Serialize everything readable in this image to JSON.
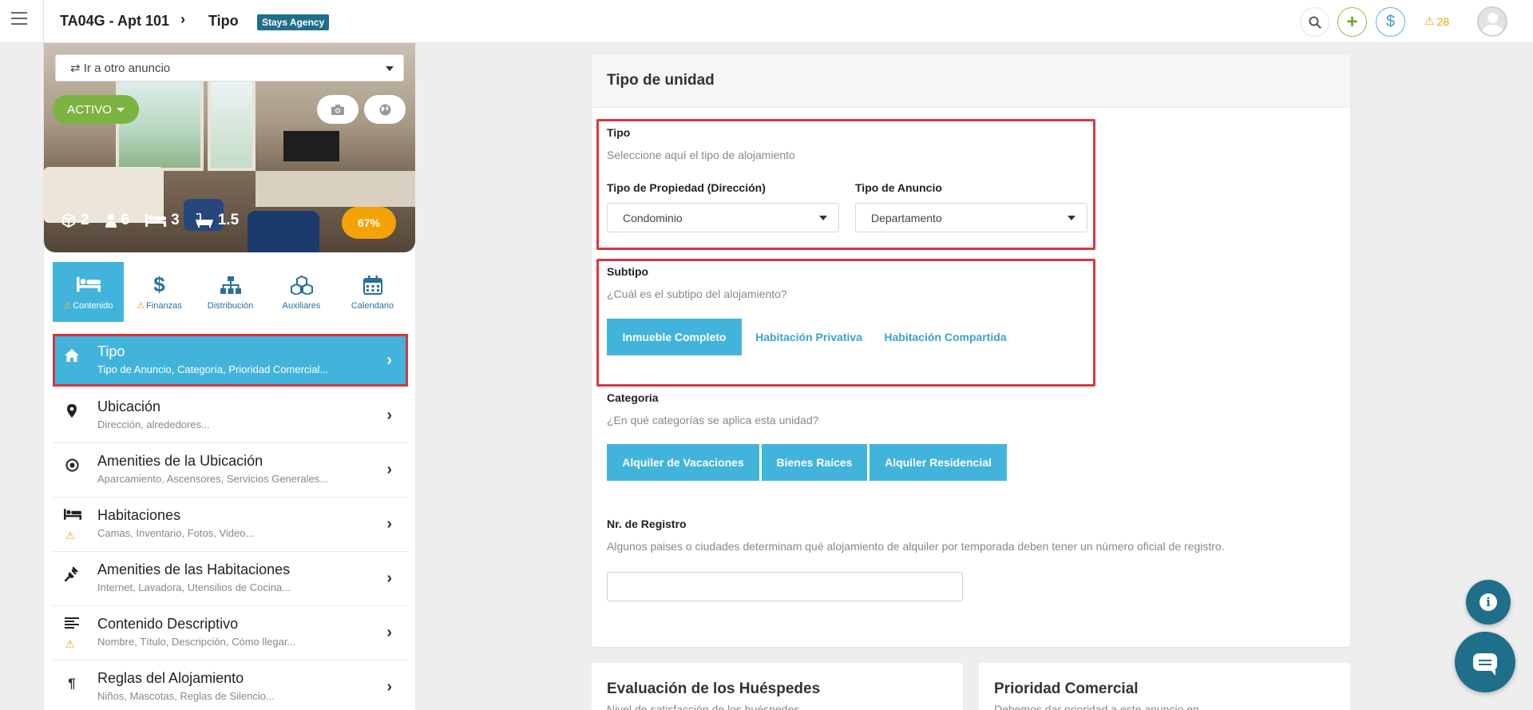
{
  "topbar": {
    "breadcrumb_listing": "TA04G - Apt 101",
    "breadcrumb_separator": "›",
    "breadcrumb_page": "Tipo",
    "agency_badge": "Stays Agency",
    "alert_count": "28",
    "colors": {
      "add": "#8bc34a",
      "money": "#3a9fd4",
      "alert": "#f0a30a",
      "badge": "#1f6f8b"
    }
  },
  "listing": {
    "goto_placeholder": "⇄ Ir a otro anuncio",
    "status": "ACTIVO",
    "stats": [
      {
        "icon": "cube-icon",
        "value": "2"
      },
      {
        "icon": "guests-icon",
        "value": "6"
      },
      {
        "icon": "bed-icon",
        "value": "3"
      },
      {
        "icon": "bathtub-icon",
        "value": "1.5"
      }
    ],
    "completion": "67%"
  },
  "nav_tabs": [
    {
      "label": "Contenido",
      "icon": "bed-icon",
      "warning": true,
      "active": true
    },
    {
      "label": "Finanzas",
      "icon": "dollar-icon",
      "warning": true,
      "active": false
    },
    {
      "label": "Distribución",
      "icon": "sitemap-icon",
      "warning": false,
      "active": false
    },
    {
      "label": "Auxiliares",
      "icon": "cubes-icon",
      "warning": false,
      "active": false
    },
    {
      "label": "Calendario",
      "icon": "calendar-icon",
      "warning": false,
      "active": false
    }
  ],
  "menu": [
    {
      "title": "Tipo",
      "subtitle": "Tipo de Anuncio, Categoría, Prioridad Comercial...",
      "icon": "home-icon",
      "active": true,
      "warning": false
    },
    {
      "title": "Ubicación",
      "subtitle": "Dirección, alrededores...",
      "icon": "map-pin-icon",
      "active": false,
      "warning": false
    },
    {
      "title": "Amenities de la Ubicación",
      "subtitle": "Aparcamiento, Ascensores, Servicios Generales...",
      "icon": "dot-circle-icon",
      "active": false,
      "warning": false
    },
    {
      "title": "Habitaciones",
      "subtitle": "Camas, Inventario, Fotos, Video...",
      "icon": "bed-icon",
      "active": false,
      "warning": true
    },
    {
      "title": "Amenities de las Habitaciones",
      "subtitle": "Internet, Lavadora, Utensilios de Cocina...",
      "icon": "plug-icon",
      "active": false,
      "warning": false
    },
    {
      "title": "Contenido Descriptivo",
      "subtitle": "Nombre, Título, Descripción, Cómo llegar...",
      "icon": "align-left-icon",
      "active": false,
      "warning": true
    },
    {
      "title": "Reglas del Alojamiento",
      "subtitle": "Niños, Mascotas, Reglas de Silencio...",
      "icon": "paragraph-icon",
      "active": false,
      "warning": false
    }
  ],
  "main": {
    "card_title": "Tipo de unidad",
    "tipo": {
      "label": "Tipo",
      "help": "Seleccione aquí el tipo de alojamiento",
      "property_type_label": "Tipo de Propiedad (Dirección)",
      "property_type_value": "Condominio",
      "listing_type_label": "Tipo de Anuncio",
      "listing_type_value": "Departamento"
    },
    "subtipo": {
      "label": "Subtipo",
      "help": "¿Cuál es el subtipo del alojamiento?",
      "options": [
        "Inmueble Completo",
        "Habitación Privativa",
        "Habitación Compartida"
      ]
    },
    "categoria": {
      "label": "Categoria",
      "help": "¿En qué categorías se aplica esta unidad?",
      "options": [
        "Alquiler de Vacaciones",
        "Bienes Raíces",
        "Alquiler Residencial"
      ]
    },
    "registro": {
      "label": "Nr. de Registro",
      "help": "Algunos paises o ciudades determinam qué alojamiento de alquiler por temporada deben tener un número oficial de registro.",
      "value": ""
    }
  },
  "bottom_cards": [
    {
      "title": "Evaluación de los Huéspedes",
      "subtitle": "Nivel de satisfacción de los huéspedes"
    },
    {
      "title": "Prioridad Comercial",
      "subtitle": "Debemos dar prioridad a este anuncio en"
    }
  ],
  "colors": {
    "primary": "#42b4dc",
    "highlight": "#d9363e",
    "active_status": "#7cb342",
    "completion": "#f4a306",
    "fab": "#1f6f8b"
  }
}
